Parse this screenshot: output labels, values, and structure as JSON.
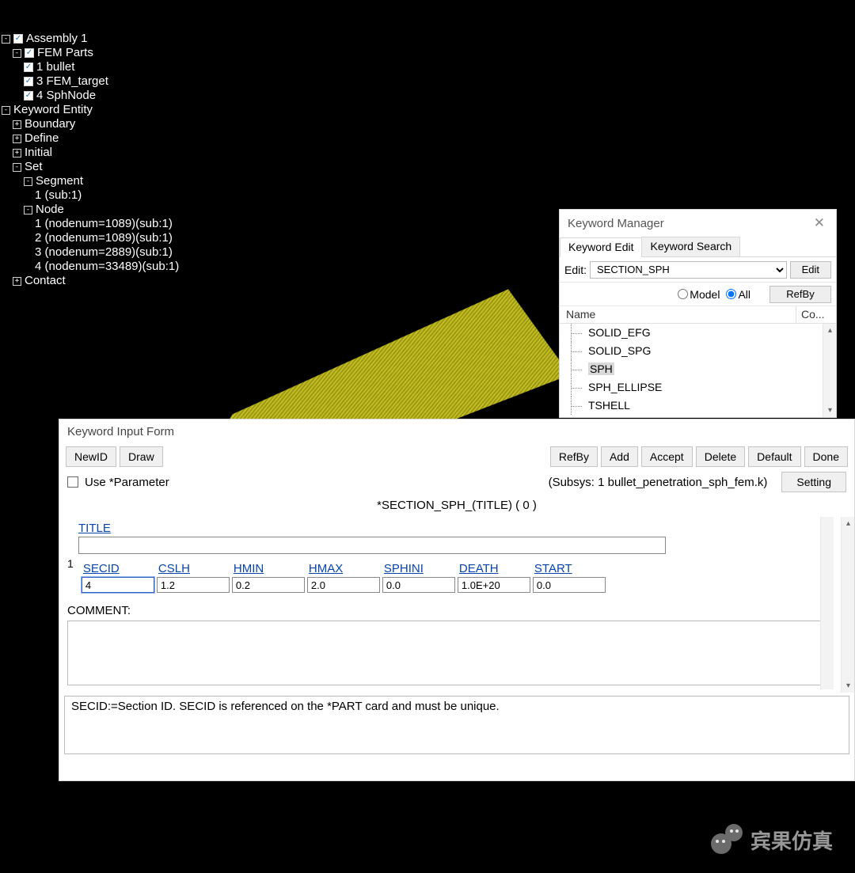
{
  "tree": {
    "assembly": "Assembly 1",
    "femParts": "FEM Parts",
    "femChildren": [
      "1 bullet",
      "3 FEM_target",
      "4 SphNode"
    ],
    "keywordEntity": "Keyword Entity",
    "kwChildren": [
      "Boundary",
      "Define",
      "Initial"
    ],
    "set": "Set",
    "segment": "Segment",
    "segmentChild": "1 (sub:1)",
    "node": "Node",
    "nodeChildren": [
      "1 (nodenum=1089)(sub:1)",
      "2 (nodenum=1089)(sub:1)",
      "3 (nodenum=2889)(sub:1)",
      "4 (nodenum=33489)(sub:1)"
    ],
    "contact": "Contact"
  },
  "kwmgr": {
    "title": "Keyword Manager",
    "tabEdit": "Keyword Edit",
    "tabSearch": "Keyword Search",
    "editLabel": "Edit:",
    "editValue": "SECTION_SPH",
    "editBtn": "Edit",
    "radioModel": "Model",
    "radioAll": "All",
    "refByBtn": "RefBy",
    "colName": "Name",
    "colCount": "Co...",
    "items": [
      "SOLID_EFG",
      "SOLID_SPG",
      "SPH",
      "SPH_ELLIPSE",
      "TSHELL"
    ],
    "selectedIdx": 2
  },
  "kif": {
    "title": "Keyword Input Form",
    "buttons": {
      "newid": "NewID",
      "draw": "Draw",
      "refby": "RefBy",
      "add": "Add",
      "accept": "Accept",
      "delete": "Delete",
      "default": "Default",
      "done": "Done",
      "setting": "Setting"
    },
    "useParam": "Use *Parameter",
    "subsys": "(Subsys: 1 bullet_penetration_sph_fem.k)",
    "cardTitle": "*SECTION_SPH_(TITLE)    ( 0 )",
    "titleField": "TITLE",
    "titleValue": "",
    "rowNum": "1",
    "fields": [
      {
        "name": "SECID",
        "value": "4"
      },
      {
        "name": "CSLH",
        "value": "1.2"
      },
      {
        "name": "HMIN",
        "value": "0.2"
      },
      {
        "name": "HMAX",
        "value": "2.0"
      },
      {
        "name": "SPHINI",
        "value": "0.0"
      },
      {
        "name": "DEATH",
        "value": "1.0E+20"
      },
      {
        "name": "START",
        "value": "0.0"
      }
    ],
    "commentLabel": "COMMENT:",
    "commentValue": "",
    "helpText": "SECID:=Section ID. SECID is referenced on the *PART card and must be unique."
  },
  "watermark": "宾果仿真"
}
